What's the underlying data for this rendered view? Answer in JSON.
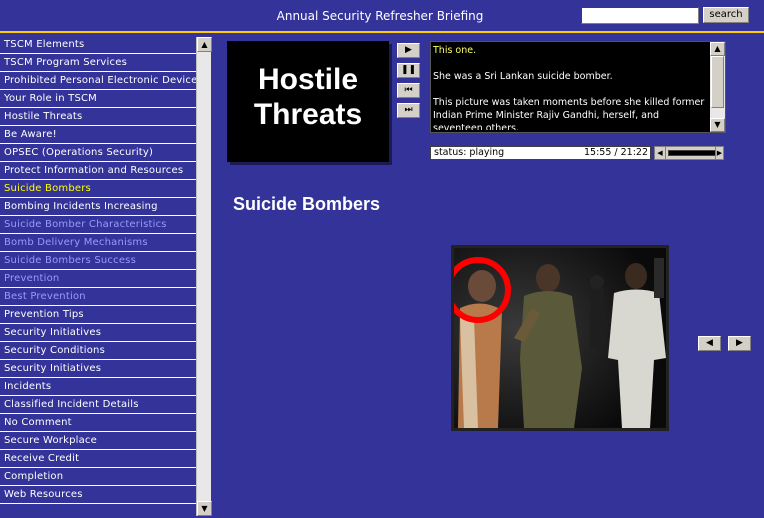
{
  "header": {
    "title": "Annual Security Refresher Briefing",
    "search_value": "",
    "search_button_label": "search",
    "accent_color": "#ffcc00"
  },
  "sidebar": {
    "items": [
      {
        "label": "TSCM Elements",
        "state": "normal"
      },
      {
        "label": "TSCM Program Services",
        "state": "normal"
      },
      {
        "label": "Prohibited Personal Electronic Devices",
        "state": "normal"
      },
      {
        "label": "Your Role in TSCM",
        "state": "normal"
      },
      {
        "label": "Hostile Threats",
        "state": "normal"
      },
      {
        "label": "Be Aware!",
        "state": "normal"
      },
      {
        "label": "OPSEC (Operations Security)",
        "state": "normal"
      },
      {
        "label": "Protect Information and Resources",
        "state": "normal"
      },
      {
        "label": "Suicide Bombers",
        "state": "active"
      },
      {
        "label": "Bombing Incidents Increasing",
        "state": "normal"
      },
      {
        "label": "Suicide Bomber Characteristics",
        "state": "visited"
      },
      {
        "label": "Bomb Delivery Mechanisms",
        "state": "visited"
      },
      {
        "label": "Suicide Bombers Success",
        "state": "visited"
      },
      {
        "label": "Prevention",
        "state": "visited"
      },
      {
        "label": "Best Prevention",
        "state": "visited"
      },
      {
        "label": "Prevention Tips",
        "state": "normal"
      },
      {
        "label": "Security Initiatives",
        "state": "normal"
      },
      {
        "label": "Security Conditions",
        "state": "normal"
      },
      {
        "label": "Security Initiatives",
        "state": "normal"
      },
      {
        "label": "Incidents",
        "state": "normal"
      },
      {
        "label": "Classified Incident Details",
        "state": "normal"
      },
      {
        "label": "No Comment",
        "state": "normal"
      },
      {
        "label": "Secure Workplace",
        "state": "normal"
      },
      {
        "label": "Receive Credit",
        "state": "normal"
      },
      {
        "label": "Completion",
        "state": "normal"
      },
      {
        "label": "Web Resources",
        "state": "normal"
      }
    ],
    "scroll_up_icon": "▲",
    "scroll_down_icon": "▼"
  },
  "module_title": {
    "line1": "Hostile",
    "line2": "Threats"
  },
  "controls": {
    "play_icon": "▶",
    "pause_icon": "❚❚",
    "rewind_icon": "⏮",
    "forward_icon": "⏭"
  },
  "transcript": {
    "heading": "This one.",
    "paragraphs": [
      "She was a Sri Lankan suicide bomber.",
      "This picture was taken moments before she killed former Indian Prime Minister Rajiv Gandhi, herself, and seventeen others."
    ]
  },
  "status": {
    "label": "status: playing",
    "time": "15:55 / 21:22",
    "volume_left_icon": "◀",
    "volume_right_icon": "▶"
  },
  "page": {
    "heading": "Suicide Bombers"
  },
  "slide_nav": {
    "prev_icon": "◀",
    "next_icon": "▶"
  }
}
